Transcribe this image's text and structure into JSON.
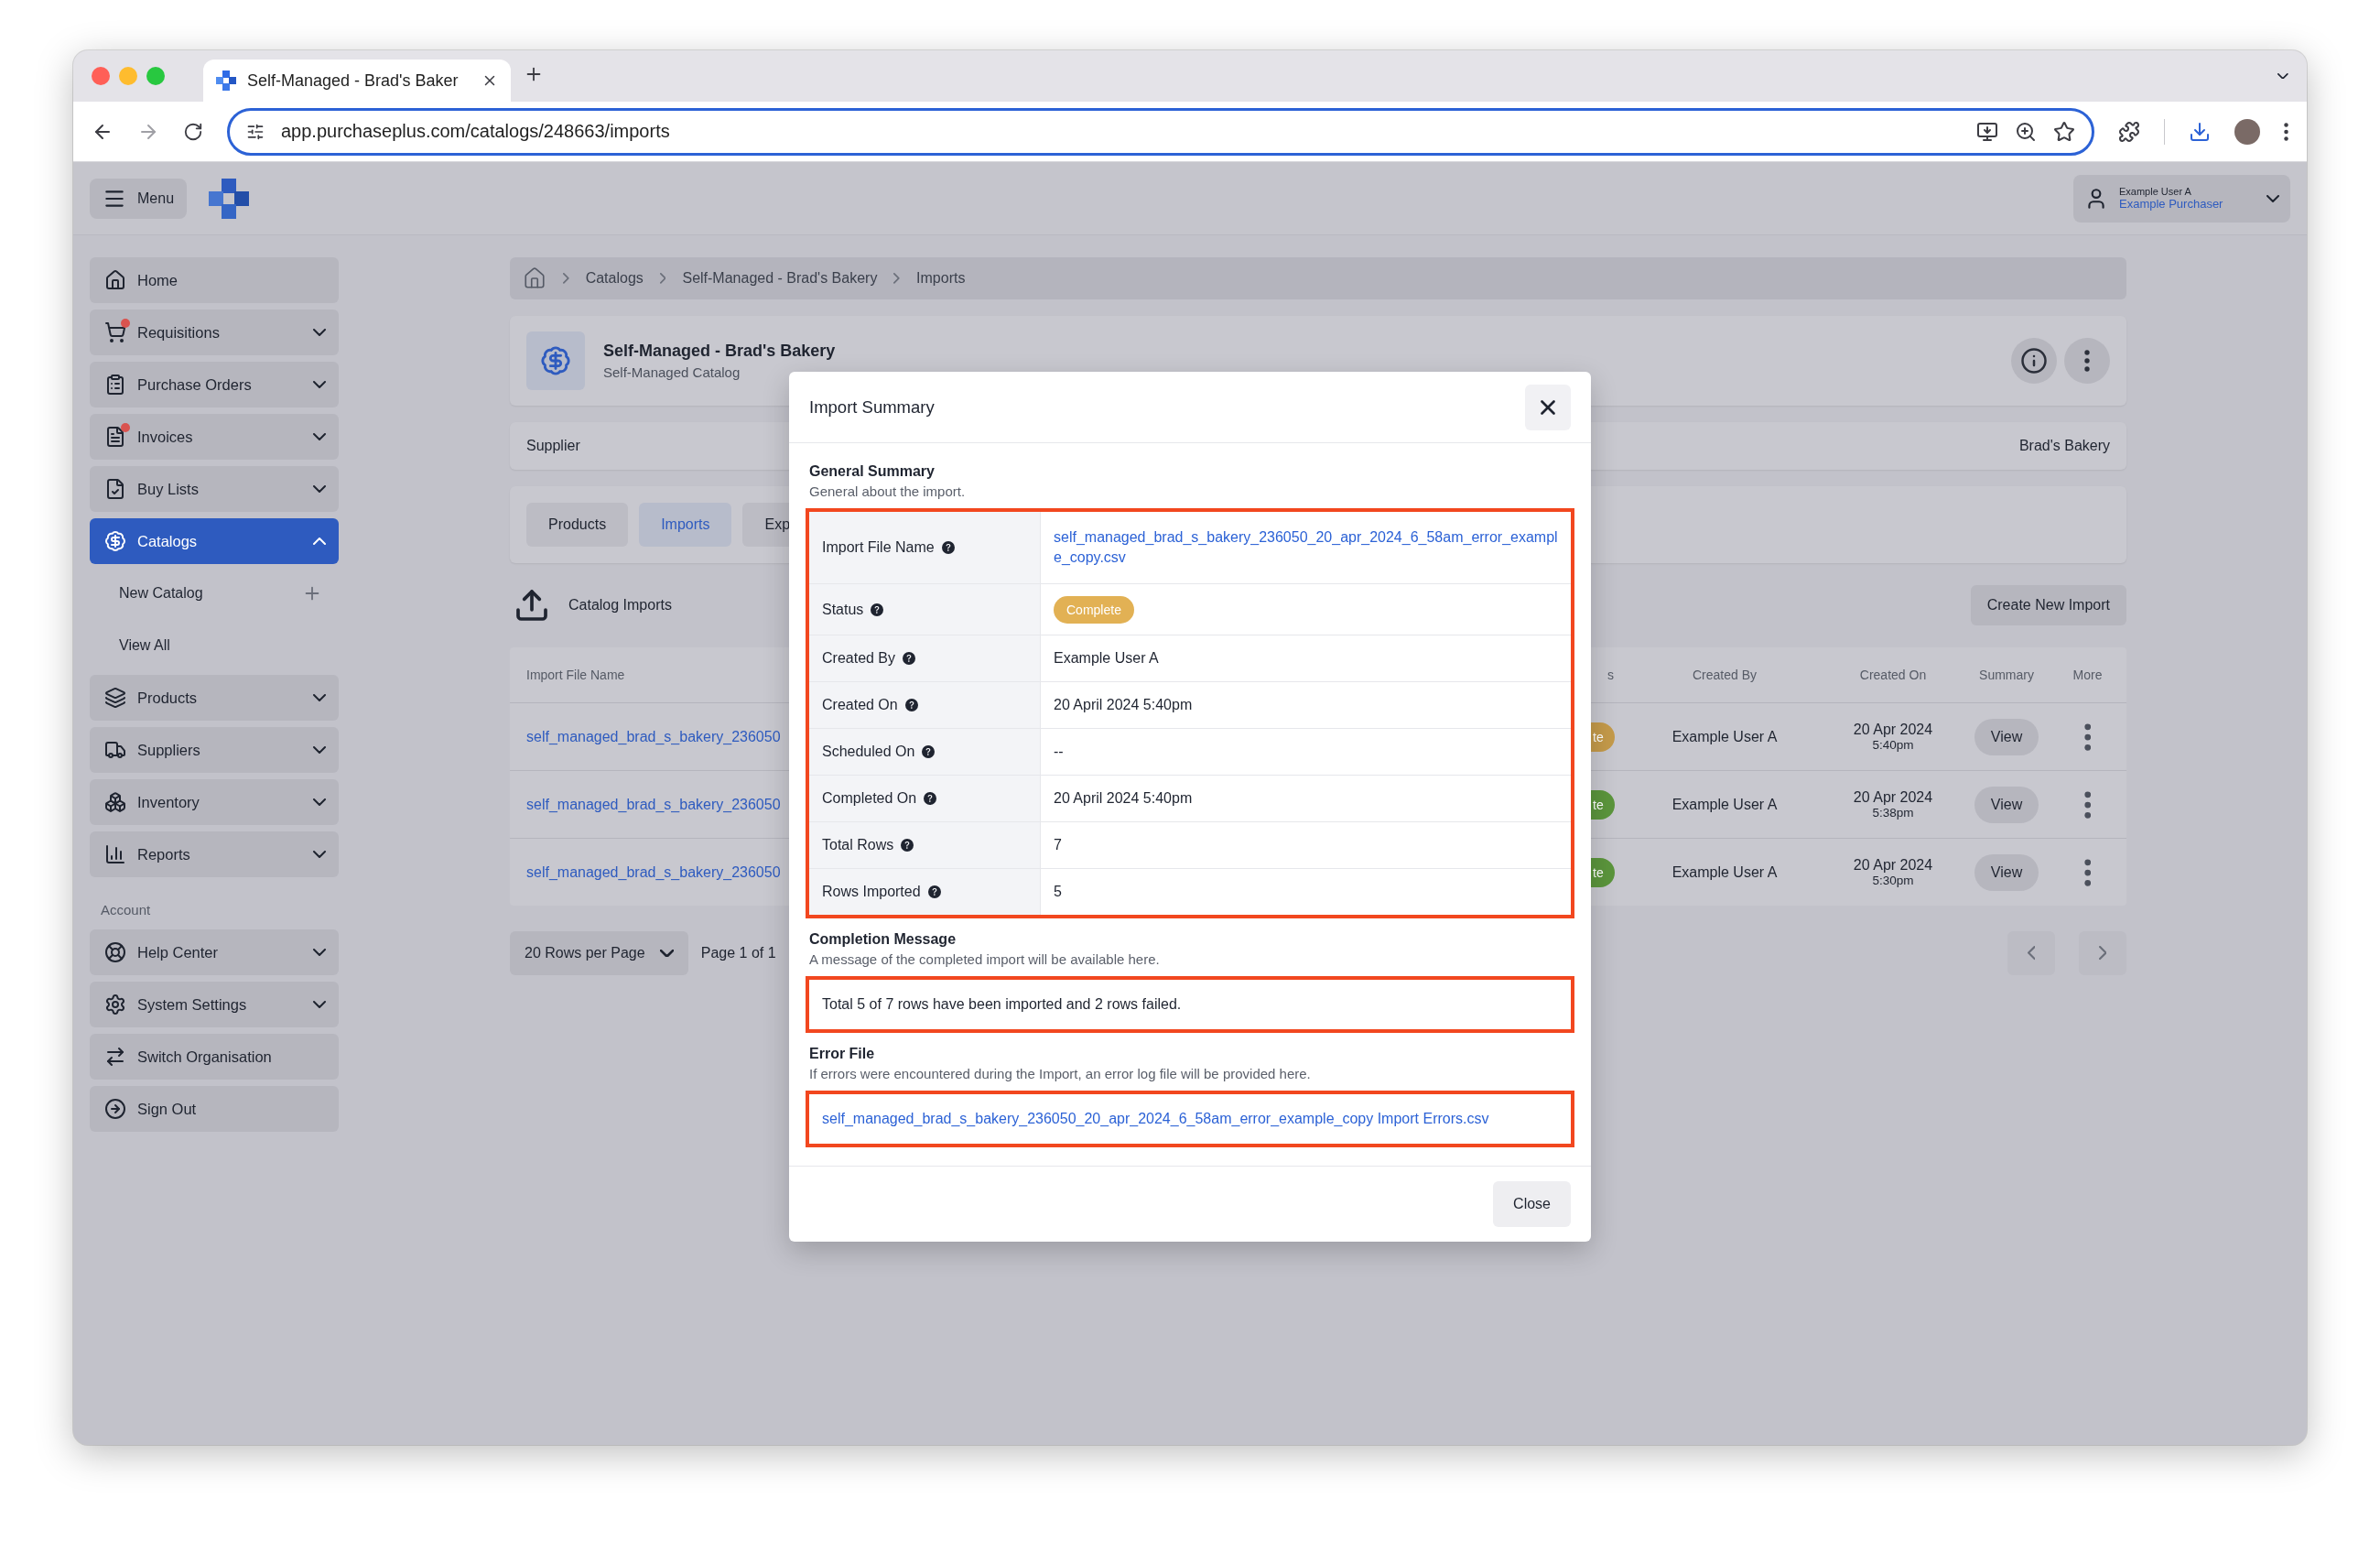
{
  "browser": {
    "tab_title": "Self-Managed - Brad's Baker",
    "url": "app.purchaseplus.com/catalogs/248663/imports"
  },
  "topbar": {
    "menu_label": "Menu",
    "user_name": "Example User A",
    "user_role": "Example Purchaser"
  },
  "sidebar": {
    "items": [
      {
        "label": "Home",
        "kind": "link",
        "selected": false,
        "notification": false
      },
      {
        "label": "Requisitions",
        "kind": "group",
        "selected": false,
        "notification": true,
        "expanded": false
      },
      {
        "label": "Purchase Orders",
        "kind": "group",
        "selected": false,
        "notification": false,
        "expanded": false
      },
      {
        "label": "Invoices",
        "kind": "group",
        "selected": false,
        "notification": true,
        "expanded": false
      },
      {
        "label": "Buy Lists",
        "kind": "group",
        "selected": false,
        "notification": false,
        "expanded": false
      },
      {
        "label": "Catalogs",
        "kind": "group",
        "selected": true,
        "notification": false,
        "expanded": true,
        "children": [
          {
            "label": "New Catalog",
            "kind": "add"
          },
          {
            "label": "View All",
            "kind": "link"
          }
        ]
      },
      {
        "label": "Products",
        "kind": "group",
        "selected": false,
        "notification": false,
        "expanded": false
      },
      {
        "label": "Suppliers",
        "kind": "group",
        "selected": false,
        "notification": false,
        "expanded": false
      },
      {
        "label": "Inventory",
        "kind": "group",
        "selected": false,
        "notification": false,
        "expanded": false
      },
      {
        "label": "Reports",
        "kind": "group",
        "selected": false,
        "notification": false,
        "expanded": false
      }
    ],
    "account_heading": "Account",
    "account_items": [
      {
        "label": "Help Center",
        "kind": "group",
        "expanded": false
      },
      {
        "label": "System Settings",
        "kind": "group",
        "expanded": false
      },
      {
        "label": "Switch Organisation",
        "kind": "link"
      },
      {
        "label": "Sign Out",
        "kind": "link"
      }
    ]
  },
  "breadcrumb": [
    "Catalogs",
    "Self-Managed - Brad's Bakery",
    "Imports"
  ],
  "catalog": {
    "title": "Self-Managed - Brad's Bakery",
    "subtitle": "Self-Managed Catalog"
  },
  "supplier": {
    "label": "Supplier",
    "value": "Brad's Bakery"
  },
  "tabs": [
    {
      "label": "Products",
      "selected": false
    },
    {
      "label": "Imports",
      "selected": true
    },
    {
      "label": "Exp",
      "selected": false
    }
  ],
  "imports": {
    "title": "Catalog Imports",
    "create_button": "Create New Import",
    "columns": [
      "Import File Name",
      "s",
      "Created By",
      "Created On",
      "Summary",
      "More"
    ],
    "rows": [
      {
        "file": "self_managed_brad_s_bakery_236050",
        "status": {
          "text": "te",
          "color": "#c49a4a"
        },
        "created_by": "Example User A",
        "date": "20 Apr 2024",
        "time": "5:40pm",
        "summary": "View"
      },
      {
        "file": "self_managed_brad_s_bakery_236050",
        "status": {
          "text": "te",
          "color": "#5b953c"
        },
        "created_by": "Example User A",
        "date": "20 Apr 2024",
        "time": "5:38pm",
        "summary": "View"
      },
      {
        "file": "self_managed_brad_s_bakery_236050",
        "status": {
          "text": "te",
          "color": "#5b953c"
        },
        "created_by": "Example User A",
        "date": "20 Apr 2024",
        "time": "5:30pm",
        "summary": "View"
      }
    ],
    "rows_per_page": "20 Rows per Page",
    "page": "Page 1 of 1"
  },
  "modal": {
    "title": "Import Summary",
    "general": {
      "heading": "General Summary",
      "description": "General about the import.",
      "highlighted": true,
      "fields": [
        {
          "label": "Import File Name",
          "kind": "link",
          "value": "self_managed_brad_s_bakery_236050_20_apr_2024_6_58am_error_example_copy.csv"
        },
        {
          "label": "Status",
          "kind": "badge",
          "value": "Complete",
          "color": "#e2b154"
        },
        {
          "label": "Created By",
          "kind": "text",
          "value": "Example User A"
        },
        {
          "label": "Created On",
          "kind": "text",
          "value": "20 April 2024 5:40pm"
        },
        {
          "label": "Scheduled On",
          "kind": "text",
          "value": "--"
        },
        {
          "label": "Completed On",
          "kind": "text",
          "value": "20 April 2024 5:40pm"
        },
        {
          "label": "Total Rows",
          "kind": "text",
          "value": "7"
        },
        {
          "label": "Rows Imported",
          "kind": "text",
          "value": "5"
        }
      ]
    },
    "completion": {
      "heading": "Completion Message",
      "description": "A message of the completed import will be available here.",
      "highlighted": true,
      "message": "Total 5 of 7 rows have been imported and 2 rows failed."
    },
    "error_file": {
      "heading": "Error File",
      "description": "If errors were encountered during the Import, an error log file will be provided here.",
      "highlighted": true,
      "link": "self_managed_brad_s_bakery_236050_20_apr_2024_6_58am_error_example_copy Import Errors.csv"
    },
    "close_button": "Close"
  }
}
